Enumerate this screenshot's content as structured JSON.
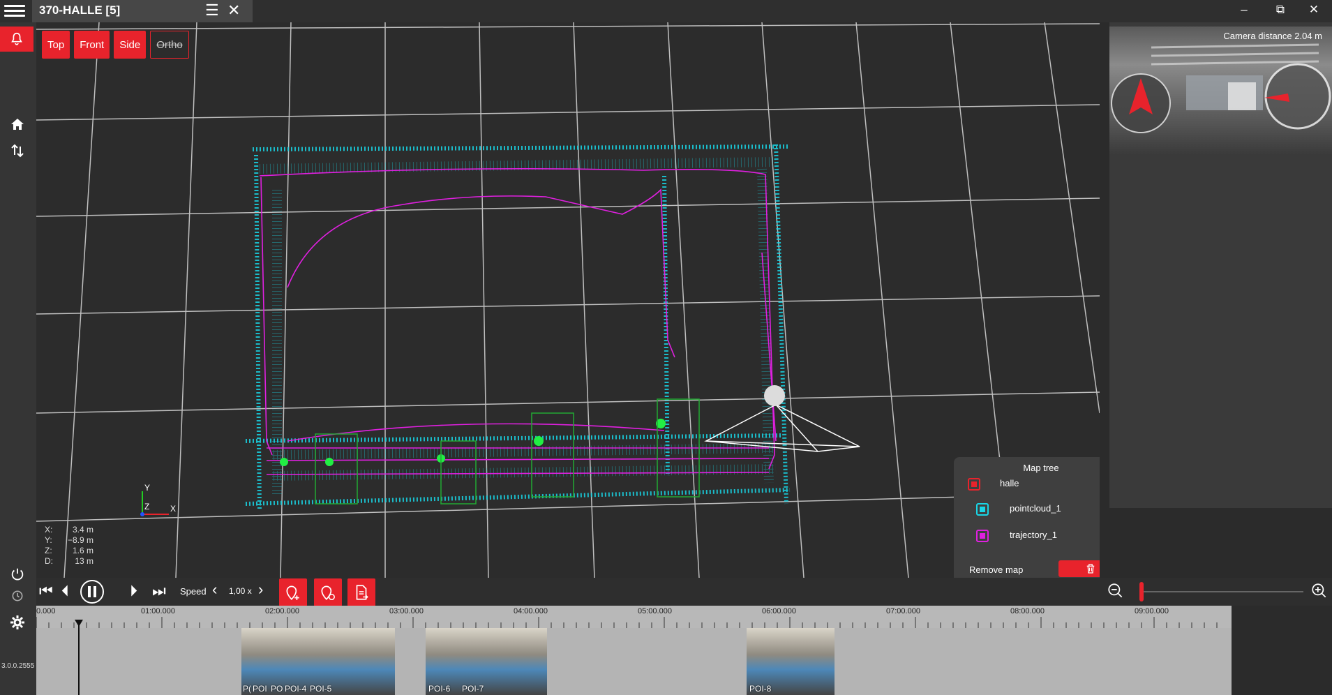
{
  "window": {
    "title": "370-HALLE [5]",
    "list_icon": "list-icon",
    "close_tab_icon": "close-icon",
    "minimize": "–",
    "restore": "⧉",
    "close": "✕"
  },
  "view_buttons": [
    {
      "label": "Top"
    },
    {
      "label": "Front"
    },
    {
      "label": "Side"
    },
    {
      "label": "Ortho"
    }
  ],
  "coords": {
    "x": {
      "k": "X:",
      "v": "3.4 m"
    },
    "y": {
      "k": "Y:",
      "v": "−8.9 m"
    },
    "z": {
      "k": "Z:",
      "v": "1.6 m"
    },
    "d": {
      "k": "D:",
      "v": "13 m"
    }
  },
  "axis": {
    "x": "X",
    "y": "Y",
    "z": "Z"
  },
  "map_tree": {
    "title": "Map tree",
    "items": [
      {
        "label": "halle",
        "color": "#e8232c"
      },
      {
        "label": "pointcloud_1",
        "color": "#19d6e6"
      },
      {
        "label": "trajectory_1",
        "color": "#e020e0"
      }
    ],
    "remove_label": "Remove map"
  },
  "side_panel": {
    "camera_distance": "Camera distance 2.04 m"
  },
  "playback": {
    "speed_label": "Speed",
    "speed_value": "1,00 x"
  },
  "version": "3.0.0.2555",
  "timeline": {
    "ticks": [
      "0.000",
      "01:00.000",
      "02:00.000",
      "03:00.000",
      "04:00.000",
      "05:00.000",
      "06:00.000",
      "07:00.000",
      "08:00.000",
      "09:00.000"
    ],
    "pois": [
      "P(",
      "POI",
      "PO",
      "POI-4",
      "POI-5",
      "POI-6",
      "POI-7",
      "POI-8"
    ]
  },
  "colors": {
    "accent": "#e8232c",
    "pointcloud": "#19d6e6",
    "trajectory": "#e020e0"
  }
}
